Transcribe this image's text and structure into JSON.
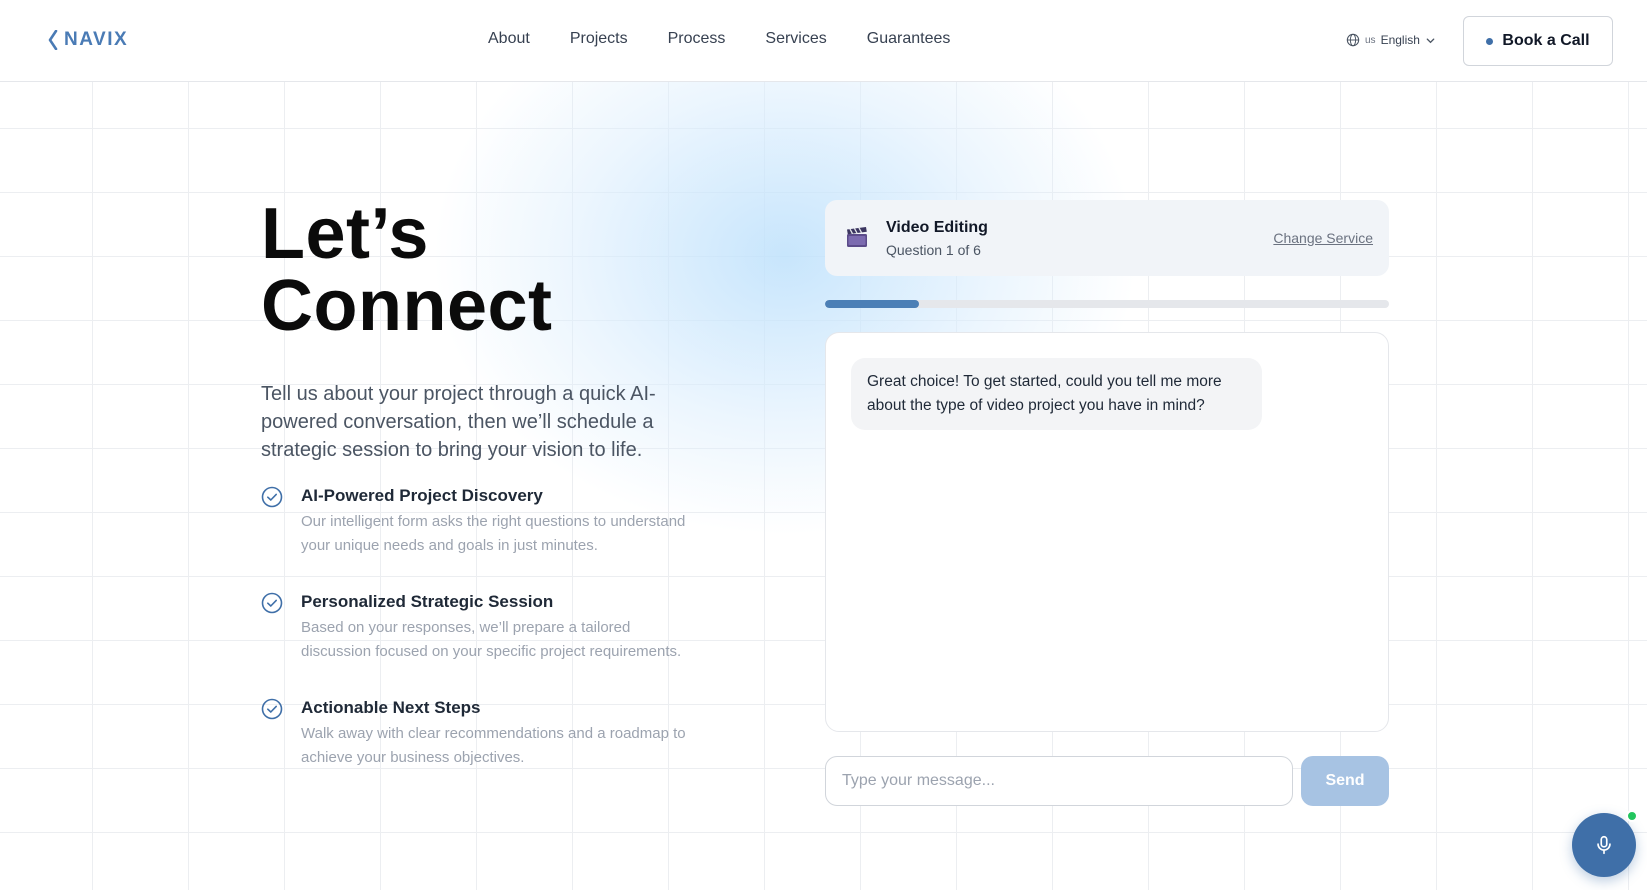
{
  "brand": {
    "name": "NAVIX",
    "color": "#4a7bb5"
  },
  "nav": {
    "items": [
      {
        "label": "About"
      },
      {
        "label": "Projects"
      },
      {
        "label": "Process"
      },
      {
        "label": "Services"
      },
      {
        "label": "Guarantees"
      }
    ]
  },
  "language": {
    "flag": "us",
    "label": "English",
    "icon": "globe-icon"
  },
  "cta": {
    "book_label": "Book a Call"
  },
  "hero": {
    "title_line1": "Let’s",
    "title_line2": "Connect",
    "subtitle": "Tell us about your project through a quick AI-powered conversation, then we’ll schedule a strategic session to bring your vision to life."
  },
  "features": [
    {
      "title": "AI-Powered Project Discovery",
      "description": "Our intelligent form asks the right questions to understand your unique needs and goals in just minutes.",
      "icon": "check-circle-icon"
    },
    {
      "title": "Personalized Strategic Session",
      "description": "Based on your responses, we’ll prepare a tailored discussion focused on your specific project requirements.",
      "icon": "check-circle-icon"
    },
    {
      "title": "Actionable Next Steps",
      "description": "Walk away with clear recommendations and a roadmap to achieve your business objectives.",
      "icon": "check-circle-icon"
    }
  ],
  "service": {
    "icon": "clapperboard-icon",
    "title": "Video Editing",
    "question_label": "Question 1 of 6",
    "change_label": "Change Service"
  },
  "progress": {
    "current": 1,
    "total": 6,
    "fraction": 0.1667,
    "color": "#4b7fb6"
  },
  "chat": {
    "messages": [
      {
        "role": "assistant",
        "text": "Great choice! To get started, could you tell me more about the type of video project you have in mind?"
      }
    ],
    "input_value": "",
    "input_placeholder": "Type your message...",
    "send_label": "Send"
  },
  "voice": {
    "icon": "microphone-icon",
    "status_color": "#22c55e"
  }
}
